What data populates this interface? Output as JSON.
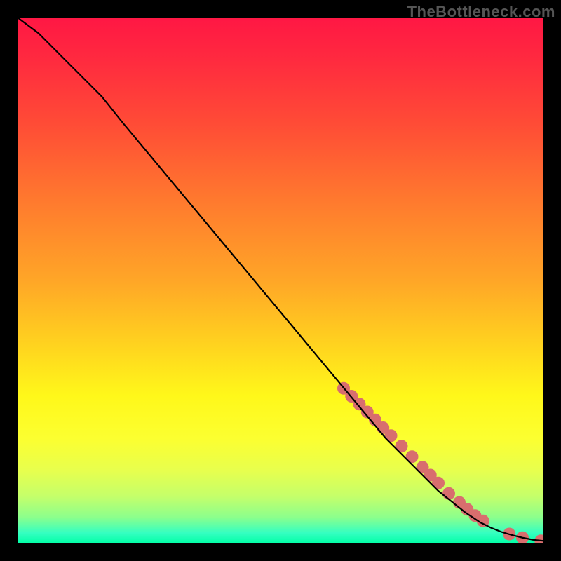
{
  "watermark": "TheBottleneck.com",
  "chart_data": {
    "type": "line",
    "title": "",
    "xlabel": "",
    "ylabel": "",
    "xlim": [
      0,
      100
    ],
    "ylim": [
      0,
      100
    ],
    "grid": false,
    "series": [
      {
        "name": "curve",
        "color": "#000000",
        "x": [
          0,
          4,
          8,
          12,
          16,
          20,
          25,
          30,
          35,
          40,
          45,
          50,
          55,
          60,
          65,
          70,
          75,
          80,
          85,
          88,
          90,
          92,
          94,
          96,
          98,
          100
        ],
        "y": [
          100,
          97,
          93,
          89,
          85,
          80,
          74,
          68,
          62,
          56,
          50,
          44,
          38,
          32,
          26,
          20,
          15,
          10,
          6,
          4,
          3,
          2.2,
          1.6,
          1.1,
          0.7,
          0.5
        ]
      }
    ],
    "points": {
      "name": "markers",
      "color": "#d86e6e",
      "x": [
        62,
        63.5,
        65,
        66.5,
        68,
        69.5,
        71,
        73,
        75,
        77,
        78.5,
        80,
        82,
        84,
        85.5,
        87,
        88.5,
        93.5,
        96,
        99.5
      ],
      "y": [
        29.5,
        28,
        26.5,
        25,
        23.5,
        22,
        20.5,
        18.5,
        16.5,
        14.5,
        13,
        11.5,
        9.5,
        7.8,
        6.5,
        5.3,
        4.3,
        1.8,
        1.1,
        0.5
      ]
    },
    "gradient_stops": [
      {
        "offset": 0.0,
        "color": "#ff1744"
      },
      {
        "offset": 0.08,
        "color": "#ff2a3f"
      },
      {
        "offset": 0.2,
        "color": "#ff4b36"
      },
      {
        "offset": 0.35,
        "color": "#ff7a2e"
      },
      {
        "offset": 0.5,
        "color": "#ffa627"
      },
      {
        "offset": 0.62,
        "color": "#ffd21f"
      },
      {
        "offset": 0.72,
        "color": "#fff81a"
      },
      {
        "offset": 0.8,
        "color": "#fcff30"
      },
      {
        "offset": 0.86,
        "color": "#e8ff4d"
      },
      {
        "offset": 0.91,
        "color": "#c5ff6a"
      },
      {
        "offset": 0.95,
        "color": "#8cff8c"
      },
      {
        "offset": 0.98,
        "color": "#35ffc1"
      },
      {
        "offset": 1.0,
        "color": "#00ffa6"
      }
    ]
  }
}
